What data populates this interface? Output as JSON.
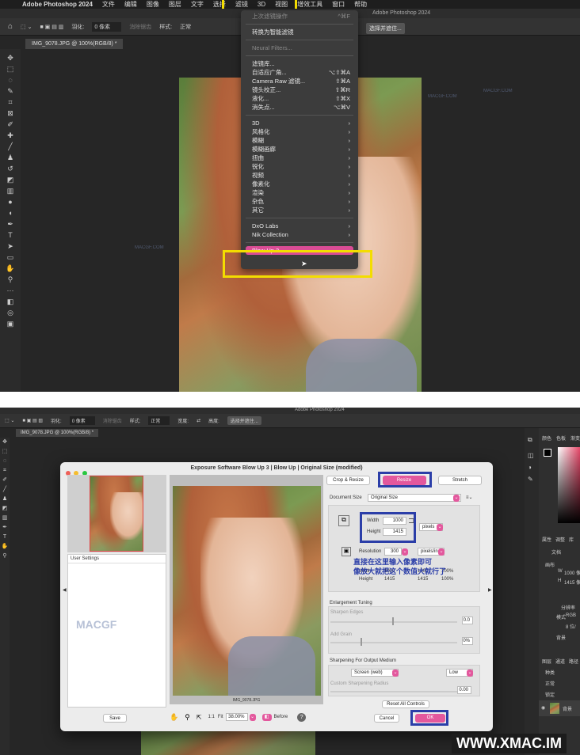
{
  "top": {
    "menubar": [
      "Adobe Photoshop 2024",
      "文件",
      "编辑",
      "图像",
      "图层",
      "文字",
      "选择",
      "滤镜",
      "3D",
      "视图",
      "增效工具",
      "窗口",
      "帮助"
    ],
    "window_title": "Adobe Photoshop 2024",
    "options": {
      "feather_label": "羽化:",
      "feather_value": "0 像素",
      "antialias": "消除锯齿",
      "style_label": "样式:",
      "style_value": "正常",
      "select_mask": "选择并遮住..."
    },
    "doc_tab": "IMG_9078.JPG @ 100%(RGB/8) *",
    "filter_menu": {
      "items_a": [
        {
          "label": "上次滤镜操作",
          "shortcut": "^⌘F",
          "disabled": true
        }
      ],
      "items_b": [
        {
          "label": "转换为智能滤镜",
          "shortcut": ""
        }
      ],
      "items_c": [
        {
          "label": "Neural Filters...",
          "shortcut": "",
          "disabled": true
        }
      ],
      "items_d": [
        {
          "label": "滤镜库...",
          "shortcut": ""
        },
        {
          "label": "自适应广角...",
          "shortcut": "⌥⇧⌘A"
        },
        {
          "label": "Camera Raw 滤镜...",
          "shortcut": "⇧⌘A"
        },
        {
          "label": "镜头校正...",
          "shortcut": "⇧⌘R"
        },
        {
          "label": "液化...",
          "shortcut": "⇧⌘X"
        },
        {
          "label": "消失点...",
          "shortcut": "⌥⌘V"
        }
      ],
      "items_e": [
        {
          "label": "3D",
          "shortcut": "›"
        },
        {
          "label": "风格化",
          "shortcut": "›"
        },
        {
          "label": "模糊",
          "shortcut": "›"
        },
        {
          "label": "模糊画廊",
          "shortcut": "›"
        },
        {
          "label": "扭曲",
          "shortcut": "›"
        },
        {
          "label": "锐化",
          "shortcut": "›"
        },
        {
          "label": "视频",
          "shortcut": "›"
        },
        {
          "label": "像素化",
          "shortcut": "›"
        },
        {
          "label": "渲染",
          "shortcut": "›"
        },
        {
          "label": "杂色",
          "shortcut": "›"
        },
        {
          "label": "其它",
          "shortcut": "›"
        }
      ],
      "items_f": [
        {
          "label": "DxO Labs",
          "shortcut": "›"
        },
        {
          "label": "Nik Collection",
          "shortcut": "›"
        }
      ],
      "highlight": "Blow Up 3..."
    },
    "watermark": "MACGF.COM"
  },
  "bottom": {
    "window_title": "Adobe Photoshop 2024",
    "options": {
      "feather_label": "羽化:",
      "feather_value": "0 像素",
      "antialias": "消除锯齿",
      "style_label": "样式:",
      "style_value": "正常",
      "width_label": "宽度:",
      "height_label": "高度:",
      "select_mask": "选择并遮住..."
    },
    "doc_tab": "IMG_9078.JPG @ 100%(RGB/8) *",
    "dialog": {
      "title": "Exposure Software Blow Up 3 | Blow Up | Original Size (modified)",
      "tabs": [
        "Crop & Resize",
        "Resize",
        "Stretch"
      ],
      "document_size_label": "Document Size",
      "document_size_value": "Original Size",
      "width_label": "Width",
      "width_value": "1000",
      "height_label": "Height",
      "height_value": "1415",
      "unit": "pixels",
      "resolution_label": "Resolution",
      "resolution_value": "300",
      "resolution_unit": "pixels/in",
      "annotation_line1": "直接在这里输入像素即可",
      "annotation_line2": "像放大就把这个数值大就行了",
      "table": {
        "rows": [
          [
            "Width",
            "1000",
            "1000",
            "100%"
          ],
          [
            "Height",
            "1415",
            "1415",
            "100%"
          ]
        ]
      },
      "enlargement_tuning": "Enlargement Tuning",
      "sharpen_edges": "Sharpen Edges",
      "sharpen_value": "0.0",
      "add_grain": "Add Grain",
      "grain_value": "0%",
      "sharpening_output": "Sharpening For Output Medium",
      "medium": "Screen (web)",
      "medium_level": "Low",
      "custom_radius": "Custom Sharpening Radius",
      "radius_value": "0.00",
      "user_settings": "User Settings",
      "file_name": "IMG_9078.JPG",
      "fit_label": "Fit",
      "zoom": "38.00%",
      "one_to_one": "1:1",
      "before": "Before",
      "reset": "Reset All Controls",
      "save": "Save",
      "cancel": "Cancel",
      "ok": "OK"
    },
    "right_panel": {
      "tabs1": [
        "颜色",
        "色板",
        "渐变"
      ],
      "tabs2": [
        "属性",
        "调整",
        "库"
      ],
      "doc_label": "文档",
      "canvas_label": "画布",
      "w_label": "W",
      "w_value": "1000 像",
      "h_label": "H",
      "h_value": "1415 像",
      "res_label": "分辨率",
      "mode_label": "模式",
      "mode_value": "RGB",
      "bits_value": "8 位/",
      "bg_label": "背景",
      "tabs3": [
        "图层",
        "通道",
        "路径"
      ],
      "kind_label": "种类",
      "normal_label": "正常",
      "lock_label": "锁定",
      "layer_name": "背景"
    },
    "site_watermark": "WWW.XMAC.IM",
    "logo_watermark": "MACGF"
  }
}
